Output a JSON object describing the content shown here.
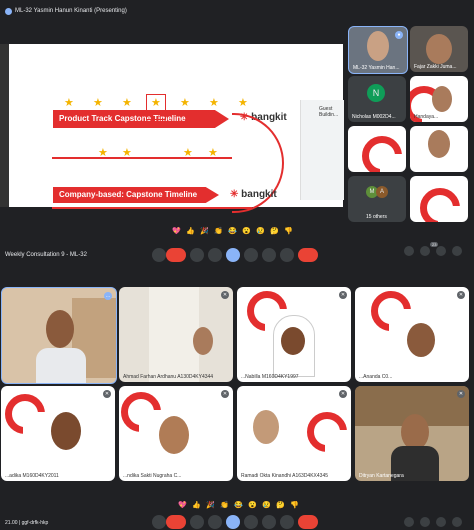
{
  "presenter": {
    "label": "ML-32 Yasmin Hanun Kinanti (Presenting)"
  },
  "slide": {
    "title1": "Product Track Capstone Timeline",
    "title2": "Company-based: Capstone Timeline",
    "brand": "bangkit",
    "side_text": "Guest Buildin..."
  },
  "top_tiles": [
    {
      "name": "ML-32 Yasmin Han..."
    },
    {
      "name": "Fajar Zakki Juma..."
    },
    {
      "name": "Nicholas M002D4...",
      "initial": "N"
    },
    {
      "name": "Handaya..."
    },
    {
      "name": ""
    },
    {
      "name": ""
    },
    {
      "name": "15 others",
      "initials": [
        "M",
        "A"
      ]
    },
    {
      "name": ""
    }
  ],
  "reactions": [
    "💖",
    "👍",
    "🎉",
    "👏",
    "😂",
    "😮",
    "😢",
    "🤔",
    "👎"
  ],
  "meeting": {
    "title": "Weekly Consultation 9 - ML-32",
    "participants_badge": "23"
  },
  "grid": [
    {
      "name": ""
    },
    {
      "name": "Ahmad Farhan Ardhanu A130D4KY4344"
    },
    {
      "name": "...Nabilla M160D4KY1997"
    },
    {
      "name": "...Ananda C0..."
    },
    {
      "name": "...adika M160D4KY2011"
    },
    {
      "name": "...ndika Sakti Nugraha C..."
    },
    {
      "name": "Ramadi Okta Kinandhi A163D4KX4345"
    },
    {
      "name": "Ditryan Kartanegara"
    }
  ],
  "bottom": {
    "time": "21.00",
    "separator": "|",
    "code": "ggf-drfk-hkp"
  },
  "colors": {
    "accent_red": "#ea4335",
    "brand_red": "#e32e2e",
    "bg": "#202124"
  }
}
